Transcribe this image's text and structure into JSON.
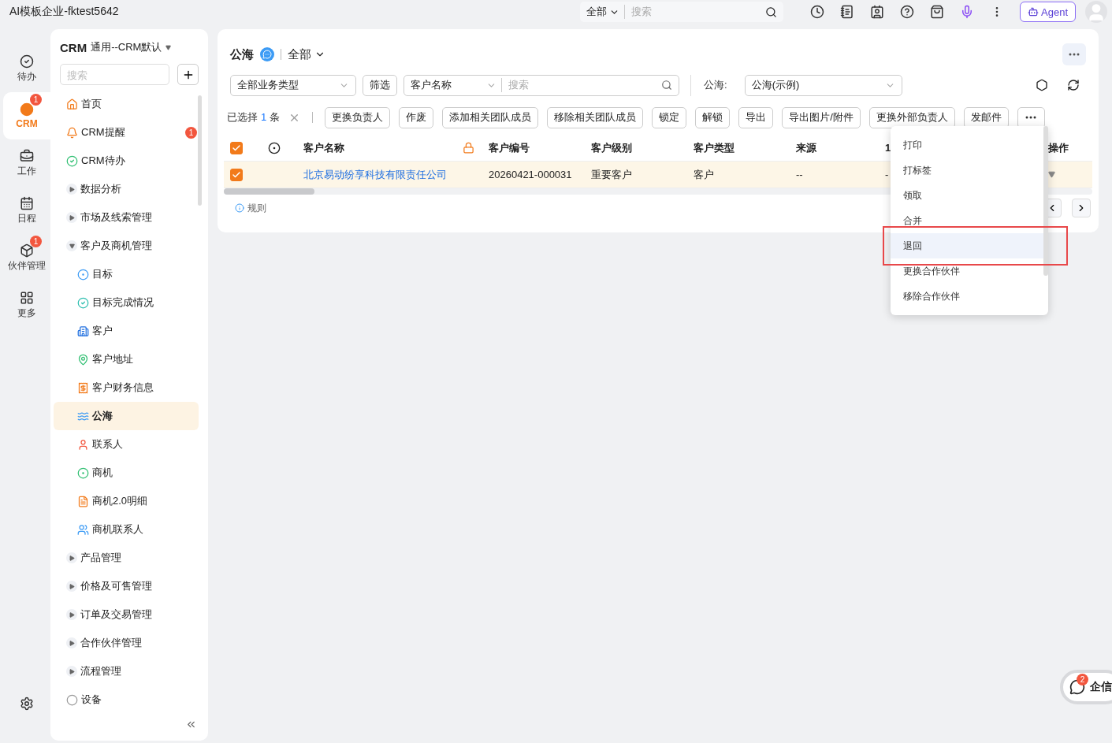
{
  "window": {
    "title": "AI模板企业-fktest5642"
  },
  "top_bar": {
    "search_scope": "全部",
    "search_placeholder": "搜索",
    "agent_button": "Agent"
  },
  "rail": [
    {
      "label": "待办",
      "selected": false
    },
    {
      "label": "CRM",
      "selected": true,
      "badge": "1"
    },
    {
      "label": "工作",
      "selected": false
    },
    {
      "label": "日程",
      "selected": false
    },
    {
      "label": "伙伴管理",
      "selected": false,
      "badge": "1"
    },
    {
      "label": "更多",
      "selected": false
    }
  ],
  "sidebar": {
    "app": "CRM",
    "scope": "通用--CRM默认",
    "search_placeholder": "搜索",
    "items": [
      {
        "kind": "link",
        "label": "首页",
        "selected": false
      },
      {
        "kind": "link",
        "label": "CRM提醒",
        "selected": false,
        "badge": "1"
      },
      {
        "kind": "link",
        "label": "CRM待办",
        "selected": false
      },
      {
        "kind": "group",
        "label": "数据分析",
        "expanded": false
      },
      {
        "kind": "group",
        "label": "市场及线索管理",
        "expanded": false
      },
      {
        "kind": "group",
        "label": "客户及商机管理",
        "expanded": true,
        "children": [
          {
            "label": "目标",
            "selected": false
          },
          {
            "label": "目标完成情况",
            "selected": false
          },
          {
            "label": "客户",
            "selected": false
          },
          {
            "label": "客户地址",
            "selected": false
          },
          {
            "label": "客户财务信息",
            "selected": false
          },
          {
            "label": "公海",
            "selected": true
          },
          {
            "label": "联系人",
            "selected": false
          },
          {
            "label": "商机",
            "selected": false
          },
          {
            "label": "商机2.0明细",
            "selected": false
          },
          {
            "label": "商机联系人",
            "selected": false
          }
        ]
      },
      {
        "kind": "group",
        "label": "产品管理",
        "expanded": false
      },
      {
        "kind": "group",
        "label": "价格及可售管理",
        "expanded": false
      },
      {
        "kind": "group",
        "label": "订单及交易管理",
        "expanded": false
      },
      {
        "kind": "group",
        "label": "合作伙伴管理",
        "expanded": false
      },
      {
        "kind": "group",
        "label": "流程管理",
        "expanded": false
      },
      {
        "kind": "link",
        "label": "设备",
        "selected": false
      }
    ]
  },
  "page": {
    "title": "公海",
    "view": "全部",
    "filters": {
      "business_type": "全部业务类型",
      "filter_button": "筛选",
      "search_field": "客户名称",
      "search_placeholder": "搜索",
      "pool_label": "公海:",
      "pool": "公海(示例)"
    },
    "selection": {
      "prefix": "已选择",
      "count": "1",
      "suffix": "条"
    },
    "actions": [
      "更换负责人",
      "作废",
      "添加相关团队成员",
      "移除相关团队成员",
      "锁定",
      "解锁",
      "导出",
      "导出图片/附件",
      "更换外部负责人",
      "发邮件"
    ],
    "table": {
      "all_checked": true,
      "columns": [
        "客户名称",
        "客户编号",
        "客户级别",
        "客户类型",
        "来源",
        "1",
        "操作"
      ],
      "rows": [
        {
          "selected": true,
          "cells": [
            "北京易动纷享科技有限责任公司",
            "20260421-000031",
            "重要客户",
            "客户",
            "--",
            "-"
          ]
        }
      ]
    },
    "rules_link": "规则",
    "menu": [
      {
        "label": "打印",
        "selected": false
      },
      {
        "label": "打标签",
        "selected": false
      },
      {
        "label": "领取",
        "selected": false
      },
      {
        "label": "合并",
        "selected": false
      },
      {
        "label": "退回",
        "selected": true
      },
      {
        "label": "更换合作伙伴",
        "selected": false
      },
      {
        "label": "移除合作伙伴",
        "selected": false
      }
    ]
  },
  "chat_button": {
    "label": "企信",
    "badge": "2"
  }
}
